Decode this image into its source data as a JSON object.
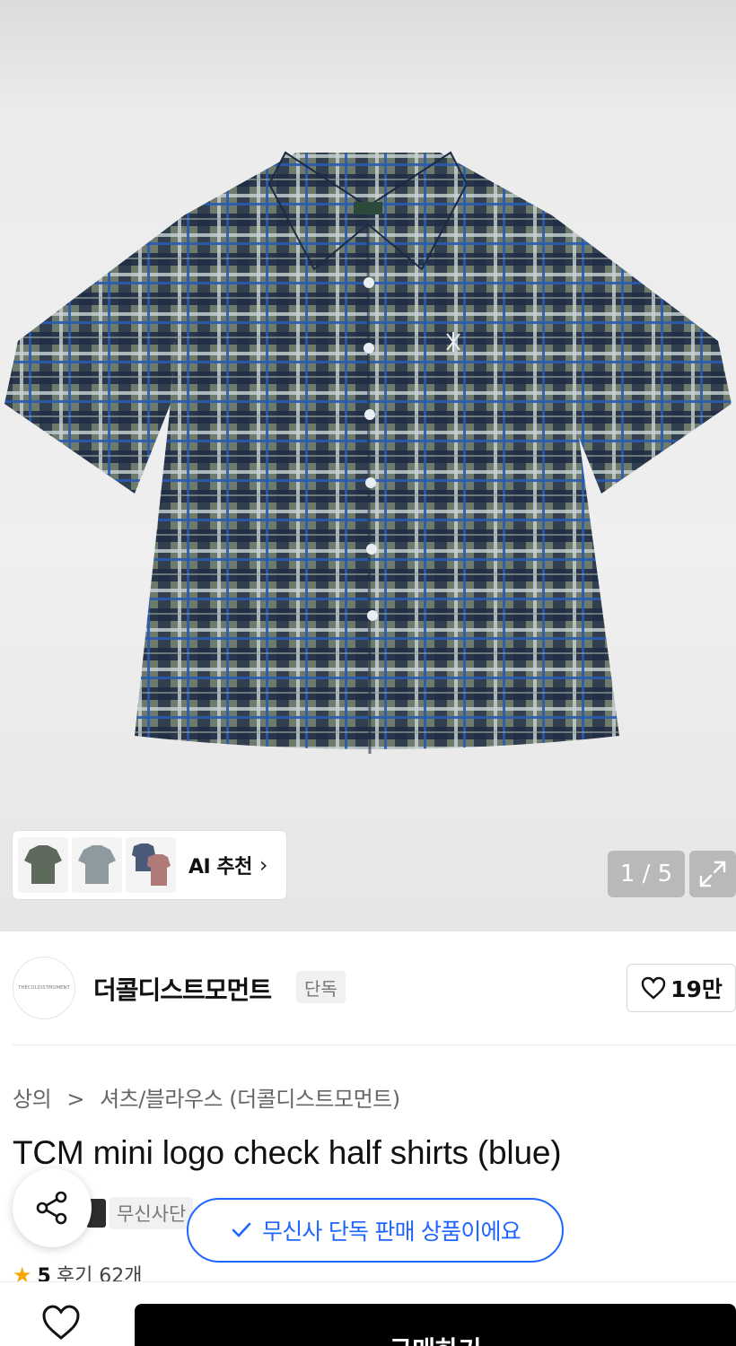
{
  "gallery": {
    "counter": "1 / 5",
    "ai_label": "AI 추천",
    "thumbnails": [
      "shirt-thumb-green",
      "shirt-thumb-gray",
      "shirt-thumb-multi"
    ]
  },
  "brand": {
    "logo_text": "THECOLDISTMOMENT",
    "name": "더콜디스트모먼트",
    "exclusive_tag": "단독",
    "likes": "19만"
  },
  "breadcrumb": {
    "level1": "상의",
    "separator": ">",
    "level2": "셔츠/블라우스 (더콜디스트모먼트)"
  },
  "product": {
    "title": "TCM mini logo check half shirts (blue)",
    "seller_badge": "무신사단",
    "rating_value": "5",
    "review_text": "후기 62개"
  },
  "toast": {
    "message": "무신사 단독 판매 상품이에요"
  },
  "bottom": {
    "buy_label": "구매하기"
  },
  "colors": {
    "accent": "#1e66ff",
    "buy_button": "#000000",
    "star": "#f6a800"
  }
}
